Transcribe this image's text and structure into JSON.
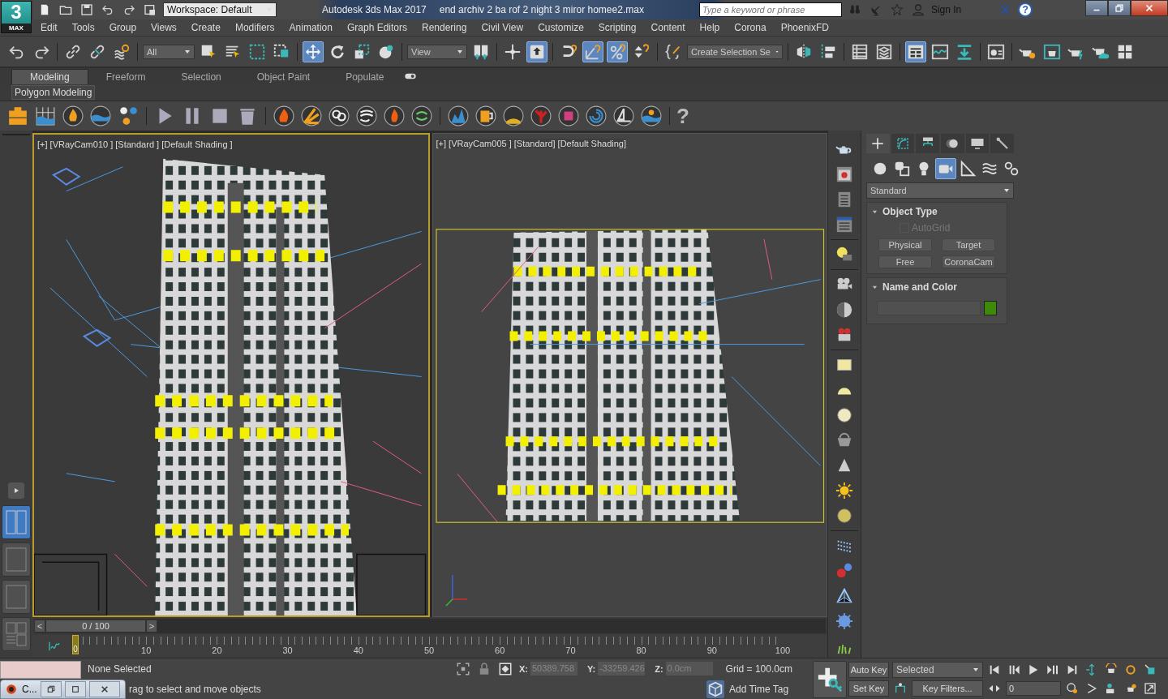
{
  "title_bar": {
    "logo_glyph": "3",
    "logo_text": "MAX",
    "workspace": "Workspace: Default",
    "app_title": "Autodesk 3ds Max 2017",
    "file_name": "end archiv 2 ba rof 2 night 3 miror homee2.max",
    "search": {
      "placeholder": "Type a keyword or phrase"
    },
    "sign_in": "Sign In",
    "help_glyph": "?"
  },
  "menu": [
    "Edit",
    "Tools",
    "Group",
    "Views",
    "Create",
    "Modifiers",
    "Animation",
    "Graph Editors",
    "Rendering",
    "Civil View",
    "Customize",
    "Scripting",
    "Content",
    "Help",
    "Corona",
    "PhoenixFD"
  ],
  "main_toolbar": [
    {
      "kind": "button",
      "selected": false
    },
    {
      "kind": "button",
      "selected": false
    },
    {
      "kind": "button",
      "selected": false
    },
    {
      "kind": "button",
      "selected": false
    },
    {
      "kind": "button",
      "selected": false
    },
    {
      "kind": "dropdown",
      "label": "All"
    },
    {
      "kind": "button",
      "selected": false
    },
    {
      "kind": "button",
      "selected": false
    },
    {
      "kind": "button",
      "selected": false
    },
    {
      "kind": "button",
      "selected": false
    },
    {
      "kind": "button",
      "selected": true
    },
    {
      "kind": "button",
      "selected": false
    },
    {
      "kind": "button",
      "selected": false
    },
    {
      "kind": "button",
      "selected": false
    },
    {
      "kind": "dropdown",
      "label": "View"
    },
    {
      "kind": "button",
      "selected": false
    },
    {
      "kind": "button",
      "selected": false
    },
    {
      "kind": "button",
      "selected": true
    },
    {
      "kind": "button",
      "selected": false
    },
    {
      "kind": "button",
      "selected": true
    },
    {
      "kind": "button",
      "selected": true
    },
    {
      "kind": "button",
      "selected": false
    },
    {
      "kind": "button",
      "selected": false
    },
    {
      "kind": "dropdown",
      "label": "Create Selection Se"
    },
    {
      "kind": "button",
      "selected": false
    },
    {
      "kind": "button",
      "selected": false
    },
    {
      "kind": "button",
      "selected": false
    },
    {
      "kind": "button",
      "selected": false
    },
    {
      "kind": "button",
      "selected": true
    },
    {
      "kind": "button",
      "selected": false
    },
    {
      "kind": "button",
      "selected": false
    },
    {
      "kind": "button",
      "selected": false
    },
    {
      "kind": "button",
      "selected": false
    },
    {
      "kind": "button",
      "selected": false
    },
    {
      "kind": "button",
      "selected": false
    },
    {
      "kind": "button",
      "selected": false
    },
    {
      "kind": "button",
      "selected": false
    }
  ],
  "ribbon": {
    "tabs": [
      {
        "label": "Modeling",
        "selected": true
      },
      {
        "label": "Freeform",
        "selected": false
      },
      {
        "label": "Selection",
        "selected": false
      },
      {
        "label": "Object Paint",
        "selected": false
      },
      {
        "label": "Populate",
        "selected": false
      }
    ],
    "panel": "Polygon Modeling"
  },
  "phoenix_toolbar": {
    "help_glyph": "?"
  },
  "viewport_layouts": [
    {
      "selected": true
    },
    {
      "selected": false
    },
    {
      "selected": false
    },
    {
      "selected": false
    }
  ],
  "viewports": [
    {
      "label": "[+] [VRayCam010 ] [Standard ] [Default Shading ]",
      "active": true
    },
    {
      "label": "[+] [VRayCam005 ] [Standard] [Default Shading]",
      "active": false
    }
  ],
  "time_slider": {
    "prev": "<",
    "position": "0 / 100",
    "next": ">"
  },
  "track_bar": {
    "current": "0",
    "labels": [
      "10",
      "20",
      "30",
      "40",
      "50",
      "60",
      "70",
      "80",
      "90",
      "100"
    ]
  },
  "command_panel": {
    "tabs": [
      {
        "selected": true
      },
      {
        "selected": false
      },
      {
        "selected": false
      },
      {
        "selected": false
      },
      {
        "selected": false
      },
      {
        "selected": false
      }
    ],
    "categories": [
      {
        "selected": false
      },
      {
        "selected": false
      },
      {
        "selected": false
      },
      {
        "selected": true
      },
      {
        "selected": false
      },
      {
        "selected": false
      },
      {
        "selected": false
      }
    ],
    "dropdown": "Standard",
    "rollouts": [
      {
        "kind": "object_type",
        "title": "Object Type",
        "expanded": true,
        "autogrid": {
          "label": "AutoGrid",
          "checked": false,
          "disabled": true
        },
        "buttons": [
          "Physical",
          "Target",
          "Free",
          "CoronaCam"
        ]
      },
      {
        "kind": "name_color",
        "title": "Name and Color",
        "expanded": true,
        "color": "#3d8a0a"
      }
    ]
  },
  "status_bar": {
    "selection": "None Selected",
    "mini_window": {
      "title": "C..."
    },
    "prompt": "rag to select and move objects",
    "coords": [
      {
        "axis": "X:",
        "value": "50389.758"
      },
      {
        "axis": "Y:",
        "value": "-33259.426"
      },
      {
        "axis": "Z:",
        "value": "0.0cm"
      }
    ],
    "grid": "Grid = 100.0cm",
    "time_tag": "Add Time Tag"
  },
  "animation_controls": {
    "auto_key": "Auto Key",
    "key_set": "Selected",
    "set_key": "Set Key",
    "key_filters": "Key Filters...",
    "frame": "0"
  }
}
